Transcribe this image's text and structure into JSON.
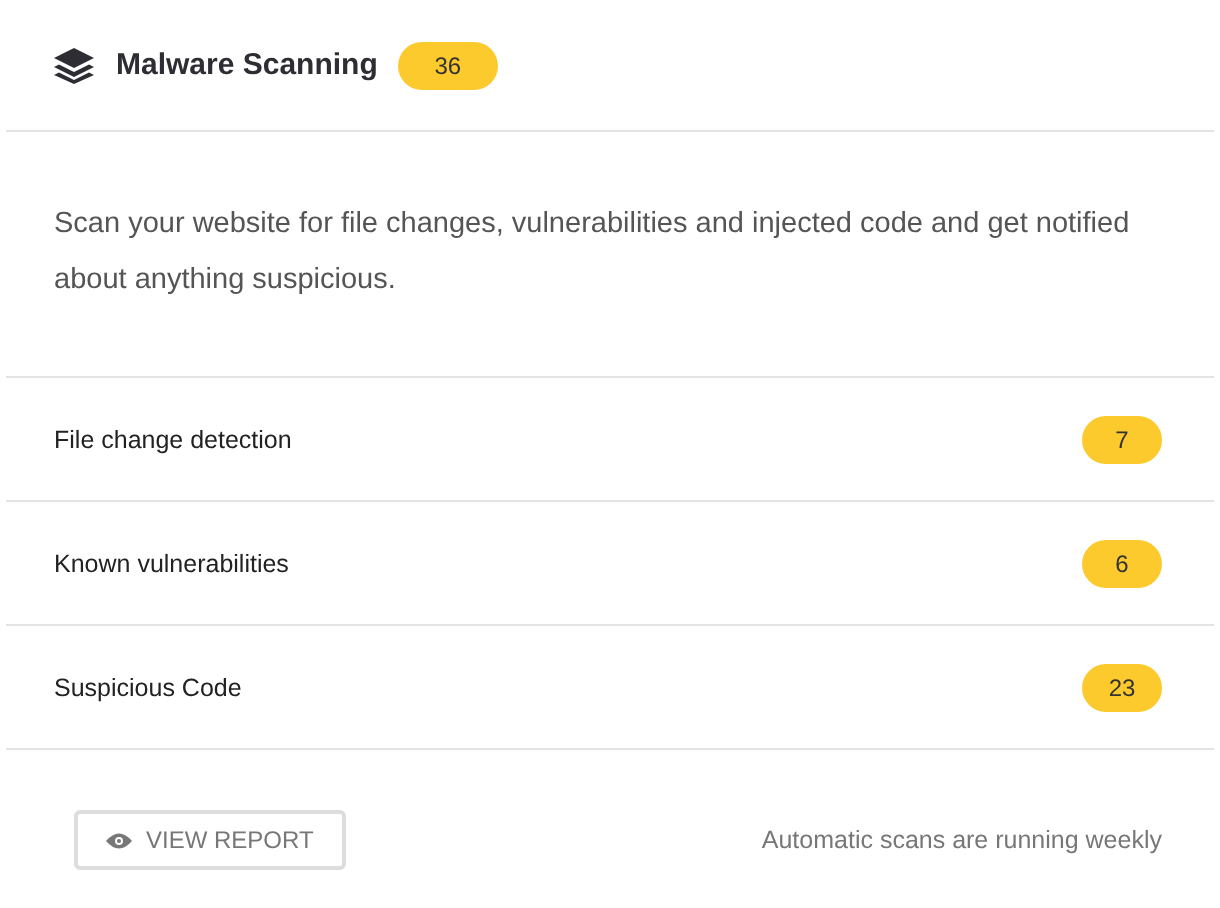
{
  "header": {
    "title": "Malware Scanning",
    "count": "36"
  },
  "description": "Scan your website for file changes, vulnerabilities and injected code and get notified about anything suspicious.",
  "rows": [
    {
      "label": "File change detection",
      "count": "7"
    },
    {
      "label": "Known vulnerabilities",
      "count": "6"
    },
    {
      "label": "Suspicious Code",
      "count": "23"
    }
  ],
  "footer": {
    "button": "VIEW REPORT",
    "note": "Automatic scans are running weekly"
  }
}
